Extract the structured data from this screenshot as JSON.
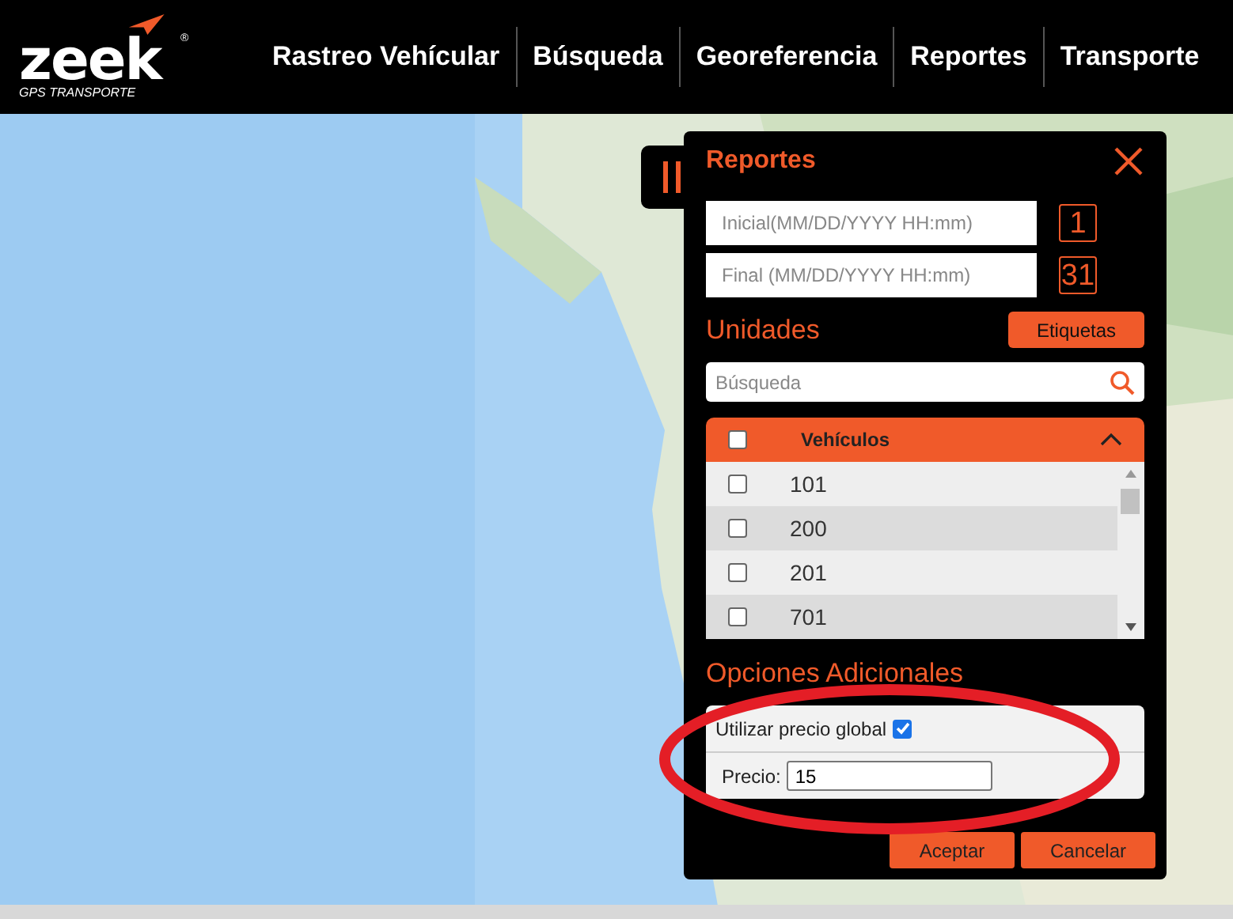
{
  "header": {
    "logo": {
      "wordmark": "zeek",
      "registered": "®",
      "tagline": "GPS TRANSPORTE"
    },
    "nav": [
      {
        "label": "Rastreo Vehícular"
      },
      {
        "label": "Búsqueda"
      },
      {
        "label": "Georeferencia"
      },
      {
        "label": "Reportes"
      },
      {
        "label": "Transporte"
      }
    ]
  },
  "panel": {
    "title": "Reportes",
    "date_fields": [
      {
        "placeholder": "Inicial(MM/DD/YYYY HH:mm)",
        "icon_text": "1"
      },
      {
        "placeholder": "Final (MM/DD/YYYY HH:mm)",
        "icon_text": "31"
      }
    ],
    "units_heading": "Unidades",
    "labels_button": "Etiquetas",
    "search": {
      "placeholder": "Búsqueda"
    },
    "vehicles": {
      "header": "Vehículos",
      "all_checked": false,
      "expanded": true,
      "rows": [
        {
          "name": "101",
          "checked": false
        },
        {
          "name": "200",
          "checked": false
        },
        {
          "name": "201",
          "checked": false
        },
        {
          "name": "701",
          "checked": false
        }
      ]
    },
    "options_heading": "Opciones Adicionales",
    "global_price": {
      "label": "Utilizar precio global",
      "checked": true
    },
    "price": {
      "label": "Precio:",
      "value": "15"
    },
    "buttons": [
      "Aceptar",
      "Cancelar"
    ]
  }
}
